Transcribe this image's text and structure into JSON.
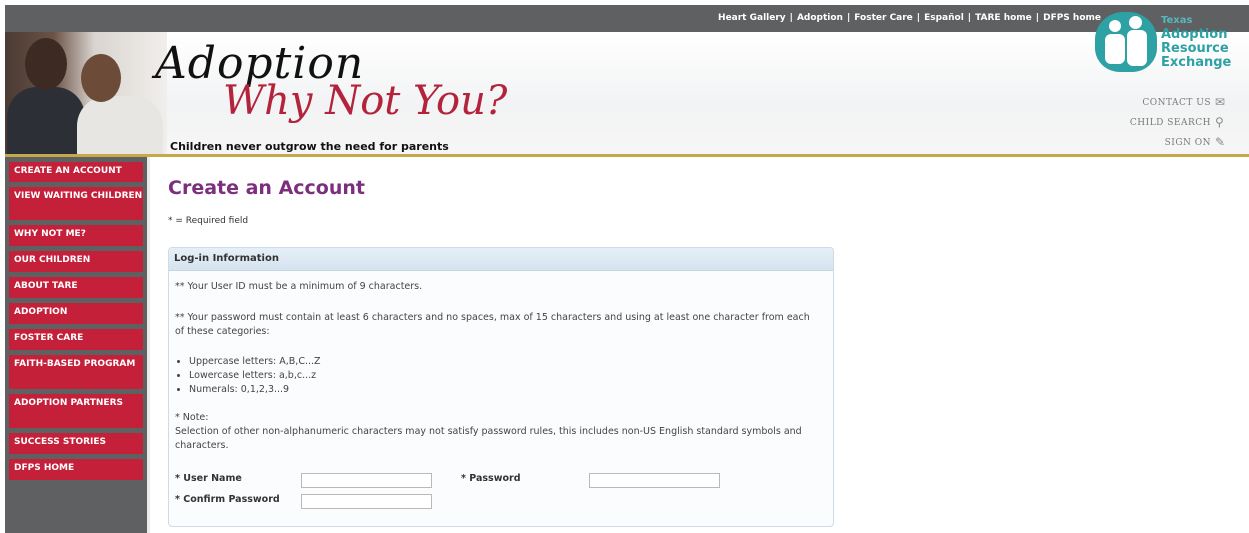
{
  "top_links": [
    "Heart Gallery",
    "Adoption",
    "Foster Care",
    "Español",
    "TARE home",
    "DFPS home"
  ],
  "banner": {
    "script_line1": "Adoption",
    "script_line2": "Why Not You?",
    "tagline": "Children never outgrow the need for parents"
  },
  "logo": {
    "state": "Texas",
    "line1": "Adoption",
    "line2": "Resource",
    "line3": "Exchange"
  },
  "utility": {
    "contact": "CONTACT US",
    "search": "CHILD SEARCH",
    "signon": "SIGN ON"
  },
  "nav": [
    "CREATE AN ACCOUNT",
    "VIEW WAITING CHILDREN",
    "WHY NOT ME?",
    "OUR CHILDREN",
    "ABOUT TARE",
    "ADOPTION",
    "FOSTER CARE",
    "FAITH-BASED PROGRAM",
    "ADOPTION PARTNERS",
    "SUCCESS STORIES",
    "DFPS HOME"
  ],
  "page": {
    "title": "Create an Account",
    "required_note": "* = Required field"
  },
  "panel": {
    "title": "Log-in Information",
    "userid_rule": "** Your User ID must be a minimum of 9 characters.",
    "password_rule": "** Your password must contain at least 6 characters and no spaces, max of 15 characters and using at least one character from each of these categories:",
    "categories": [
      "Uppercase letters: A,B,C...Z",
      "Lowercase letters: a,b,c...z",
      "Numerals: 0,1,2,3...9"
    ],
    "note_label": "* Note:",
    "note_text": "Selection of other non-alphanumeric characters may not satisfy password rules, this includes non-US English standard symbols and characters."
  },
  "form": {
    "username_label": "* User Name",
    "password_label": "* Password",
    "confirm_label": "* Confirm Password",
    "username_value": "",
    "password_value": "",
    "confirm_value": ""
  }
}
